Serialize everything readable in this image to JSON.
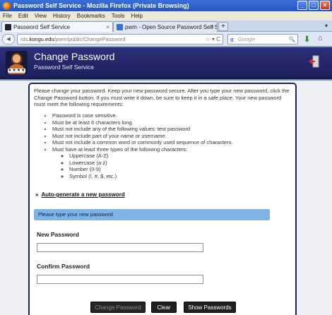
{
  "window": {
    "title": "Password Self Service - Mozilla Firefox (Private Browsing)",
    "min": "_",
    "max": "□",
    "close": "×"
  },
  "menu": [
    "File",
    "Edit",
    "View",
    "History",
    "Bookmarks",
    "Tools",
    "Help"
  ],
  "tabs": [
    {
      "label": "Password Self Service",
      "close": "×"
    },
    {
      "label": "pwm - Open Source Password Self Servic...",
      "close": "×"
    }
  ],
  "tabbar": {
    "new_tab": "+",
    "scroll": "▾"
  },
  "nav": {
    "back": "◄",
    "url_prefix": "rds.",
    "url_domain": "kongu.edu",
    "url_path": "/pwm/public/ChangePassword",
    "url_icons": "☆ ▾ C",
    "search_engine": "g",
    "search_placeholder": "Google",
    "search_icon": "🔍",
    "download_icon": "⬇",
    "home_icon": "⌂"
  },
  "header": {
    "title": "Change Password",
    "subtitle": "Password Self Service",
    "avatar_stars": "★★★★"
  },
  "content": {
    "intro": "Please change your password. Keep your new password secure. After you type your new password, click the Change Password button. If you must write it down, be sure to keep it in a safe place. Your new password must meet the following requirements:",
    "requirements": [
      "Password is case sensitive.",
      "Must be at least 6 characters long.",
      "Must not include any of the following values: test password",
      "Must not include part of your name or username.",
      "Must not include a common word or commonly used sequence of characters.",
      "Must have at least three types of the following characters:"
    ],
    "char_types": [
      "Uppercase (A-Z)",
      "Lowercase (a-z)",
      "Number (0-9)",
      "Symbol (!, #, $, etc.)"
    ],
    "autogen_prefix": "»",
    "autogen_link": "Auto-generate a new password",
    "message": "Please type your new password",
    "new_password_label": "New Password",
    "new_password_value": "",
    "confirm_password_label": "Confirm Password",
    "confirm_password_value": ""
  },
  "buttons": {
    "change": "Change Password",
    "clear": "Clear",
    "show": "Show Passwords"
  },
  "colors": {
    "header": "#2d2f7a",
    "message_bar": "#7fb2e8",
    "button": "#1f1f1f"
  }
}
